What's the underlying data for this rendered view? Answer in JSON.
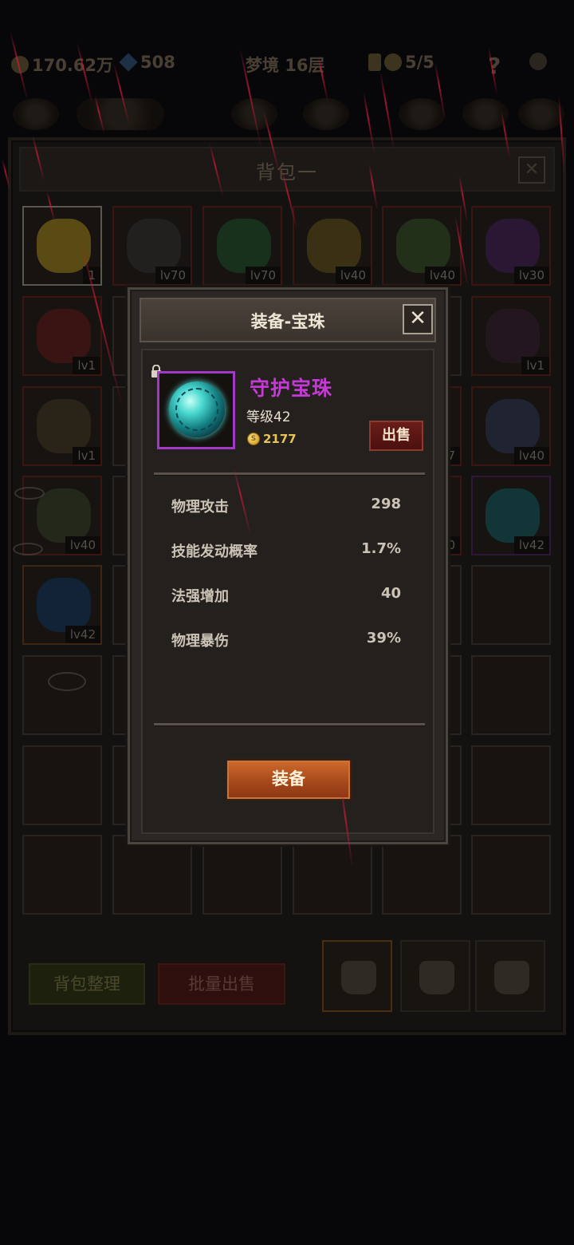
{
  "top_bar": {
    "gold": "170.62万",
    "gems": "508",
    "stage": "梦境 16层",
    "keys": "5/5",
    "help": "?"
  },
  "bag": {
    "title": "背包一",
    "close": "✕",
    "items": [
      {
        "lv": "1",
        "frame": "sel",
        "color": "#5a4a14"
      },
      {
        "lv": "lv70",
        "frame": "red",
        "color": "#22201f"
      },
      {
        "lv": "lv70",
        "frame": "red",
        "color": "#17311d"
      },
      {
        "lv": "lv40",
        "frame": "red",
        "color": "#3a3014"
      },
      {
        "lv": "lv40",
        "frame": "red",
        "color": "#233019"
      },
      {
        "lv": "lv30",
        "frame": "red",
        "color": "#2a1733"
      },
      {
        "lv": "lv1",
        "frame": "red",
        "color": "#3a1412"
      },
      {
        "lv": "",
        "frame": "",
        "color": ""
      },
      {
        "lv": "",
        "frame": "",
        "color": ""
      },
      {
        "lv": "",
        "frame": "",
        "color": ""
      },
      {
        "lv": "",
        "frame": "",
        "color": ""
      },
      {
        "lv": "lv1",
        "frame": "red",
        "color": "#24161f"
      },
      {
        "lv": "lv1",
        "frame": "red",
        "color": "#2a2418"
      },
      {
        "lv": "",
        "frame": "",
        "color": ""
      },
      {
        "lv": "",
        "frame": "",
        "color": ""
      },
      {
        "lv": "",
        "frame": "",
        "color": ""
      },
      {
        "lv": "7",
        "frame": "red",
        "color": "#2a1515"
      },
      {
        "lv": "lv40",
        "frame": "red",
        "color": "#202332"
      },
      {
        "lv": "lv40",
        "frame": "red",
        "color": "#23281a"
      },
      {
        "lv": "",
        "frame": "",
        "color": ""
      },
      {
        "lv": "",
        "frame": "",
        "color": ""
      },
      {
        "lv": "",
        "frame": "",
        "color": ""
      },
      {
        "lv": "0",
        "frame": "red",
        "color": "#2a2418"
      },
      {
        "lv": "lv42",
        "frame": "purple",
        "color": "#123638"
      },
      {
        "lv": "lv42",
        "frame": "orange",
        "color": "#122338"
      }
    ],
    "sort_label": "背包整理",
    "bulk_sell_label": "批量出售"
  },
  "modal": {
    "title": "装备-宝珠",
    "close": "✕",
    "item_name": "守护宝珠",
    "level": "等级42",
    "price": "2177",
    "coin_glyph": "S",
    "sell_label": "出售",
    "stats": [
      {
        "label": "物理攻击",
        "value": "298"
      },
      {
        "label": "技能发动概率",
        "value": "1.7%"
      },
      {
        "label": "法强增加",
        "value": "40"
      },
      {
        "label": "物理暴伤",
        "value": "39%"
      }
    ],
    "equip_label": "装备"
  },
  "colors": {
    "item_name": "#c33bd2",
    "frame_purple": "#a238c6",
    "equip_button": "#b5511f",
    "rain": "#d01a3a"
  }
}
